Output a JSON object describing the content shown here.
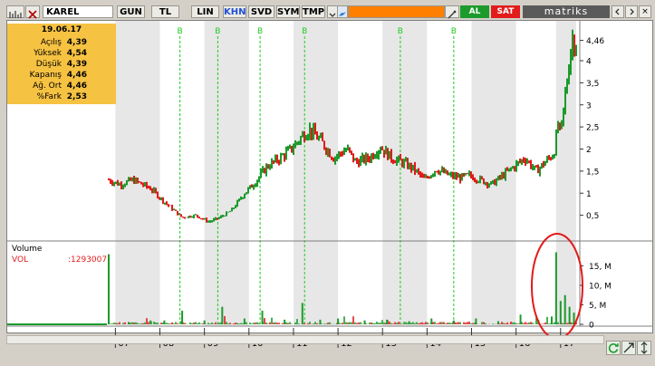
{
  "toolbar": {
    "symbol": "KAREL",
    "periods": [
      "GUN",
      "TL",
      "LIN",
      "KHN",
      "SVD",
      "SYM",
      "TMP"
    ],
    "active_period": "KHN",
    "buy_label": "AL",
    "sell_label": "SAT",
    "brand": "matriks",
    "close_glyph": "×"
  },
  "colors": {
    "up": "#1c9a2c",
    "down": "#e21b1b",
    "shade": "#e7e7e7",
    "signal": "#1fcc1f",
    "info_bg": "#f6c242",
    "annotation": "#e21b1b"
  },
  "info_panel": {
    "date": "19.06.17",
    "rows": [
      {
        "label": "Açılış",
        "value": "4,39"
      },
      {
        "label": "Yüksek",
        "value": "4,54"
      },
      {
        "label": "Düşük",
        "value": "4,39"
      },
      {
        "label": "Kapanış",
        "value": "4,46"
      },
      {
        "label": "Ağ. Ort",
        "value": "4,46"
      },
      {
        "label": "%Fark",
        "value": "2,53"
      }
    ]
  },
  "volume_panel": {
    "title": "Volume",
    "series_label": "VOL",
    "value": ":1293007"
  },
  "chart_data": [
    {
      "type": "line",
      "name": "price",
      "y_ticks": [
        "0,5",
        "1",
        "1,5",
        "2",
        "2,5",
        "3",
        "3,5",
        "4",
        "4,46"
      ],
      "ylim": [
        0,
        4.8
      ],
      "x_ticks": [
        "07",
        "08",
        "09",
        "10",
        "11",
        "12",
        "13",
        "14",
        "15",
        "16",
        "17"
      ],
      "signals": [
        "B",
        "B",
        "B",
        "B",
        "B",
        "B"
      ],
      "signal_years": [
        2008.45,
        2009.3,
        2010.25,
        2011.25,
        2013.4,
        2014.6
      ],
      "x": [
        2006.85,
        2007.1,
        2007.4,
        2007.8,
        2008.1,
        2008.5,
        2008.8,
        2009.1,
        2009.35,
        2009.6,
        2009.9,
        2010.1,
        2010.4,
        2010.7,
        2010.95,
        2011.2,
        2011.35,
        2011.6,
        2011.9,
        2012.2,
        2012.4,
        2012.7,
        2012.95,
        2013.2,
        2013.45,
        2013.7,
        2013.95,
        2014.2,
        2014.5,
        2014.75,
        2014.95,
        2015.2,
        2015.45,
        2015.7,
        2015.95,
        2016.2,
        2016.45,
        2016.7,
        2016.85,
        2016.95,
        2017.0,
        2017.08,
        2017.15,
        2017.25,
        2017.35
      ],
      "y": [
        1.3,
        1.2,
        1.3,
        1.1,
        0.8,
        0.45,
        0.5,
        0.35,
        0.45,
        0.6,
        1.0,
        1.2,
        1.6,
        1.8,
        2.0,
        2.3,
        2.45,
        2.2,
        1.8,
        2.0,
        1.7,
        1.8,
        2.05,
        1.8,
        1.7,
        1.55,
        1.3,
        1.55,
        1.4,
        1.35,
        1.4,
        1.3,
        1.2,
        1.4,
        1.6,
        1.8,
        1.5,
        1.75,
        1.9,
        2.6,
        2.3,
        3.0,
        3.6,
        4.5,
        4.46
      ]
    },
    {
      "type": "bar",
      "name": "volume",
      "y_ticks": [
        "15, M",
        "10, M",
        "5, M",
        "0"
      ],
      "ylim": [
        0,
        20
      ],
      "x": [
        2006.85,
        2007.3,
        2007.8,
        2008.1,
        2008.5,
        2009.0,
        2009.4,
        2009.9,
        2010.3,
        2010.8,
        2011.2,
        2011.6,
        2012.0,
        2012.6,
        2013.1,
        2013.6,
        2014.1,
        2014.6,
        2015.1,
        2015.6,
        2016.1,
        2016.5,
        2016.8,
        2016.9,
        2017.0,
        2017.1,
        2017.2,
        2017.3
      ],
      "y": [
        18,
        0.5,
        0.8,
        1.0,
        3.5,
        1.0,
        4.5,
        1.5,
        3.5,
        1.2,
        5.5,
        1.2,
        1.5,
        1.0,
        1.2,
        0.8,
        1.5,
        1.0,
        1.5,
        0.8,
        2.5,
        1.2,
        2.0,
        18.5,
        6.0,
        7.5,
        4.5,
        3.0
      ]
    }
  ]
}
